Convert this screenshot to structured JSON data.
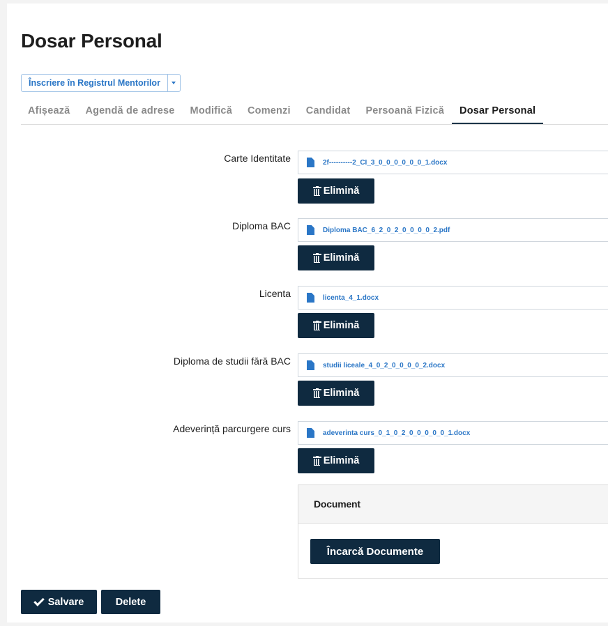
{
  "page": {
    "title": "Dosar Personal"
  },
  "action_dropdown": {
    "label": "Înscriere în Registrul Mentorilor"
  },
  "tabs": [
    {
      "label": "Afișează",
      "active": false
    },
    {
      "label": "Agendă de adrese",
      "active": false
    },
    {
      "label": "Modifică",
      "active": false
    },
    {
      "label": "Comenzi",
      "active": false
    },
    {
      "label": "Candidat",
      "active": false
    },
    {
      "label": "Persoană Fizică",
      "active": false
    },
    {
      "label": "Dosar Personal",
      "active": true
    }
  ],
  "documents": [
    {
      "label": "Carte Identitate",
      "file": "2f----------2_CI_3_0_0_0_0_0_0_1.docx",
      "remove_label": "Elimină"
    },
    {
      "label": "Diploma BAC",
      "file": "Diploma BAC_6_2_0_2_0_0_0_0_2.pdf",
      "remove_label": "Elimină"
    },
    {
      "label": "Licenta",
      "file": "licenta_4_1.docx",
      "remove_label": "Elimină"
    },
    {
      "label": "Diploma de studii fără BAC",
      "file": "studii liceale_4_0_2_0_0_0_0_2.docx",
      "remove_label": "Elimină"
    },
    {
      "label": "Adeverință parcurgere curs",
      "file": "adeverinta curs_0_1_0_2_0_0_0_0_0_1.docx",
      "remove_label": "Elimină"
    }
  ],
  "upload_panel": {
    "header": "Document",
    "button_label": "Încarcă Documente"
  },
  "footer": {
    "save_label": "Salvare",
    "delete_label": "Delete"
  },
  "colors": {
    "primary_dark": "#0f2a40",
    "link_blue": "#2a76c6"
  },
  "icons": [
    "caret-down-icon",
    "file-icon",
    "trash-icon",
    "check-icon"
  ]
}
